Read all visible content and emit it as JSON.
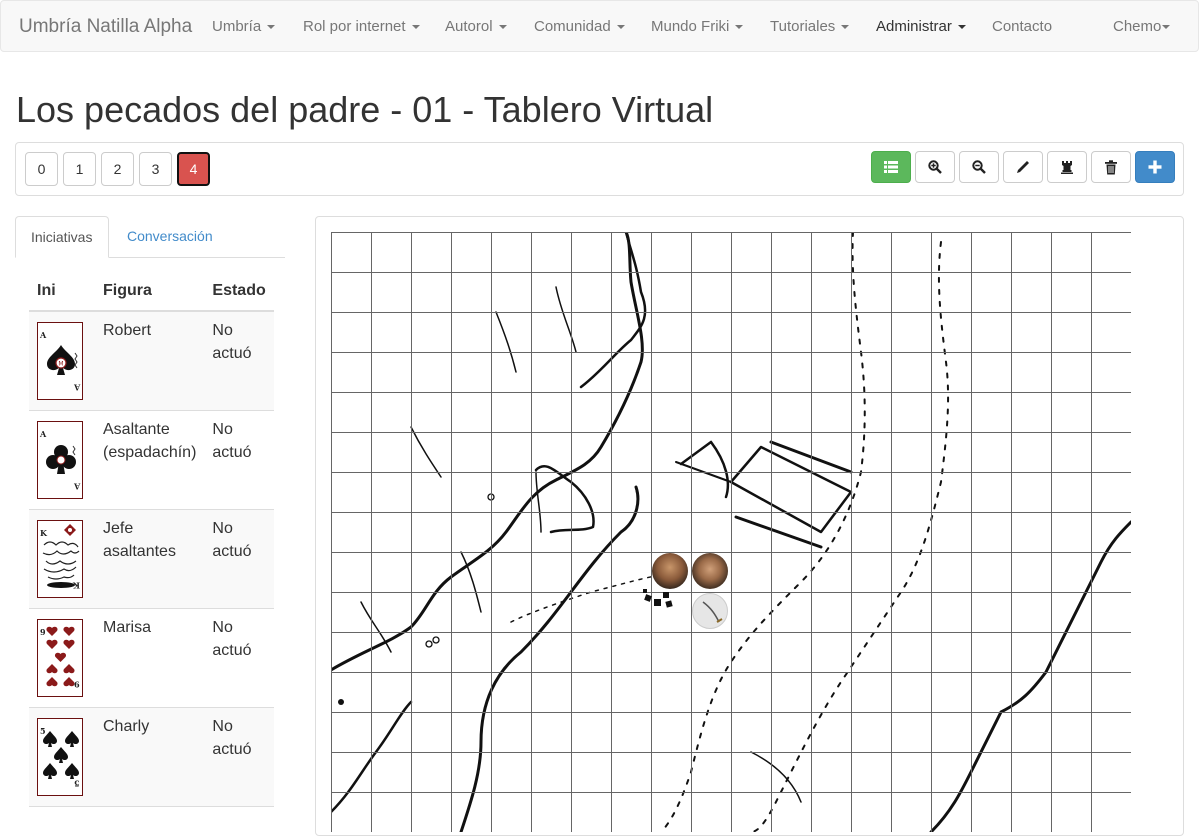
{
  "navbar": {
    "brand": "Umbría Natilla Alpha",
    "items": [
      {
        "label": "Umbría",
        "dropdown": true
      },
      {
        "label": "Rol por internet",
        "dropdown": true
      },
      {
        "label": "Autorol",
        "dropdown": true
      },
      {
        "label": "Comunidad",
        "dropdown": true
      },
      {
        "label": "Mundo Friki",
        "dropdown": true
      },
      {
        "label": "Tutoriales",
        "dropdown": true
      },
      {
        "label": "Administrar",
        "dropdown": true,
        "active": true
      },
      {
        "label": "Contacto",
        "dropdown": false
      }
    ],
    "user": {
      "label": "Chemo",
      "dropdown": true
    }
  },
  "page": {
    "title": "Los pecados del padre - 01 - Tablero Virtual"
  },
  "toolbar": {
    "layers": [
      "0",
      "1",
      "2",
      "3",
      "4"
    ],
    "active_layer": "4",
    "tools": [
      {
        "name": "list",
        "icon": "list-icon",
        "style": "success"
      },
      {
        "name": "zoom-in",
        "icon": "zoom-in-icon",
        "style": "default"
      },
      {
        "name": "zoom-out",
        "icon": "zoom-out-icon",
        "style": "default"
      },
      {
        "name": "draw",
        "icon": "pencil-icon",
        "style": "default"
      },
      {
        "name": "tower",
        "icon": "tower-icon",
        "style": "default"
      },
      {
        "name": "delete",
        "icon": "trash-icon",
        "style": "default"
      },
      {
        "name": "add",
        "icon": "plus-icon",
        "style": "primary"
      }
    ],
    "colors": {
      "danger": "#d9534f",
      "success": "#5cb85c",
      "primary": "#428bca"
    }
  },
  "sidebar": {
    "tabs": [
      {
        "label": "Iniciativas",
        "active": true
      },
      {
        "label": "Conversación",
        "active": false
      }
    ],
    "table": {
      "headers": [
        "Ini",
        "Figura",
        "Estado"
      ],
      "rows": [
        {
          "card": "As de espadas",
          "card_icon": "ace-of-spades-card",
          "figura": "Robert",
          "estado": "No actuó"
        },
        {
          "card": "As de bastos",
          "card_icon": "ace-of-clubs-card",
          "figura": "Asaltante (espadachín)",
          "estado": "No actuó"
        },
        {
          "card": "Rey de diamantes",
          "card_icon": "king-of-diamonds-card",
          "figura": "Jefe asaltantes",
          "estado": "No actuó"
        },
        {
          "card": "9 de corazones",
          "card_icon": "nine-of-hearts-card",
          "figura": "Marisa",
          "estado": "No actuó"
        },
        {
          "card": "5 de espadas",
          "card_icon": "five-of-spades-card",
          "figura": "Charly",
          "estado": "No actuó"
        }
      ]
    }
  },
  "map": {
    "tokens": [
      {
        "name": "bearded-warrior",
        "type": "portrait"
      },
      {
        "name": "young-warrior",
        "type": "portrait"
      },
      {
        "name": "sword",
        "type": "item"
      }
    ]
  }
}
